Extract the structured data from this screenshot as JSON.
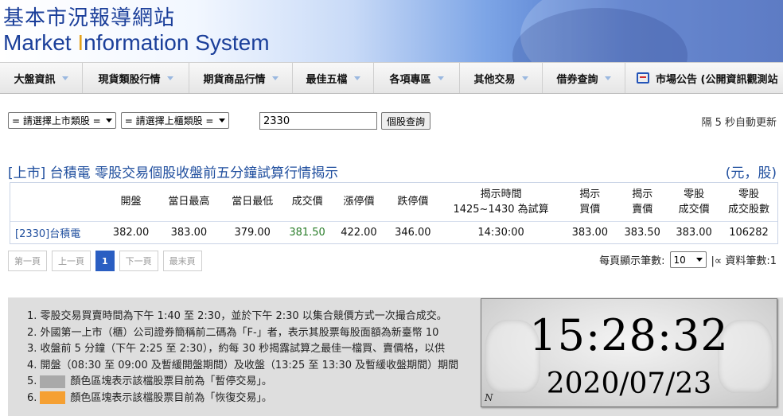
{
  "banner": {
    "title_cn": "基本市況報導網站",
    "title_en_part1": "Market ",
    "title_en_part2": "I",
    "title_en_part3": "nformation System"
  },
  "nav": {
    "items": [
      {
        "label": "大盤資訊"
      },
      {
        "label": "現貨類股行情"
      },
      {
        "label": "期貨商品行情"
      },
      {
        "label": "最佳五檔"
      },
      {
        "label": "各項專區"
      },
      {
        "label": "其他交易"
      },
      {
        "label": "借券查詢"
      }
    ],
    "announcement_label": "市場公告 (公開資訊觀測站"
  },
  "controls": {
    "listed_select": "= 請選擇上市類股 =",
    "otc_select": "= 請選擇上櫃類股 =",
    "stock_input_value": "2330",
    "query_button": "個股查詢",
    "refresh_note": "隔 5 秒自動更新"
  },
  "section": {
    "title": "[上市] 台積電 零股交易個股收盤前五分鐘試算行情揭示",
    "unit": "(元，股)"
  },
  "table": {
    "headers": [
      {
        "l1": "",
        "l2": ""
      },
      {
        "l1": "開盤",
        "l2": ""
      },
      {
        "l1": "當日最高",
        "l2": ""
      },
      {
        "l1": "當日最低",
        "l2": ""
      },
      {
        "l1": "成交價",
        "l2": ""
      },
      {
        "l1": "漲停價",
        "l2": ""
      },
      {
        "l1": "跌停價",
        "l2": ""
      },
      {
        "l1": "揭示時間",
        "l2": "1425~1430 為試算"
      },
      {
        "l1": "揭示",
        "l2": "買價"
      },
      {
        "l1": "揭示",
        "l2": "賣價"
      },
      {
        "l1": "零股",
        "l2": "成交價"
      },
      {
        "l1": "零股",
        "l2": "成交股數"
      }
    ],
    "row": {
      "name": "[2330]台積電",
      "open": "382.00",
      "high": "383.00",
      "low": "379.00",
      "last": "381.50",
      "limit_up": "422.00",
      "limit_down": "346.00",
      "time": "14:30:00",
      "bid": "383.00",
      "ask": "383.50",
      "odd_price": "383.00",
      "odd_volume": "106282"
    }
  },
  "pager": {
    "first": "第一頁",
    "prev": "上一頁",
    "current": "1",
    "next": "下一頁",
    "last": "最末頁",
    "per_page_label": "每頁顯示筆數:",
    "per_page_value": "10",
    "total_label": "|∝ 資料筆數:1"
  },
  "notes": {
    "n1": "1. 零股交易買賣時間為下午 1:40 至 2:30，並於下午 2:30 以集合競價方式一次撮合成交。",
    "n2": "2. 外國第一上市（櫃）公司證券簡稱前二碼為「F-」者，表示其股票每股面額為新臺幣 10",
    "n3": "3. 收盤前 5 分鐘（下午 2:25 至 2:30），約每 30 秒揭露試算之最佳一檔買、賣價格，以供",
    "n4": "4. 開盤（08:30 至 09:00 及暫緩開盤期間）及收盤（13:25 至 13:30 及暫緩收盤期間）期間",
    "n5_num": "5.",
    "n5_text": "顏色區塊表示該檔股票目前為「暫停交易」。",
    "n6_num": "6.",
    "n6_text": "顏色區塊表示該檔股票目前為「恢復交易」。",
    "color_suspend": "#a9a9a9",
    "color_resume": "#f5a033"
  },
  "clock": {
    "time": "15:28:32",
    "date": "2020/07/23",
    "mark": "N"
  }
}
